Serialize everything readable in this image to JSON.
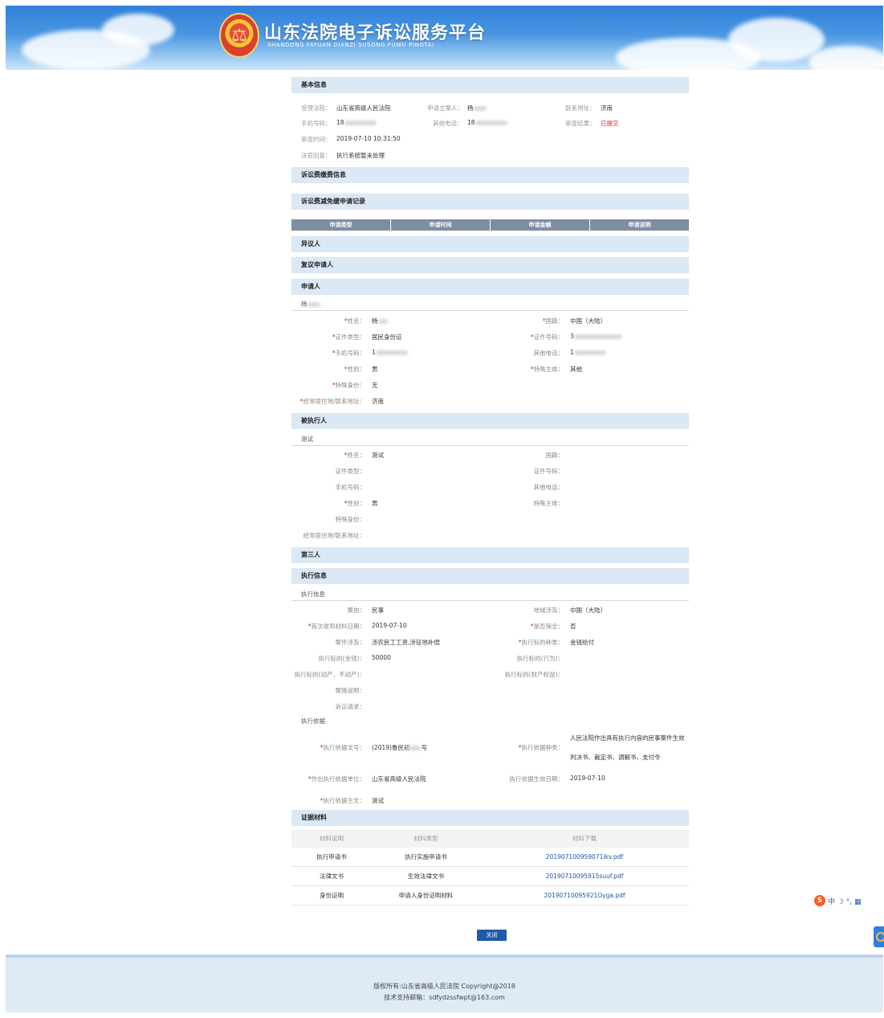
{
  "header": {
    "title": "山东法院电子诉讼服务平台",
    "subtitle": "SHANDONG FAYUAN DIANZI SUSONG FUWU PINGTAI"
  },
  "basic": {
    "title": "基本信息",
    "court_label": "受理法院：",
    "court_value": "山东省高级人民法院",
    "applicant_label": "申请立案人：",
    "applicant_value": "杨",
    "address_label": "联系地址：",
    "address_value": "济南",
    "phone_label": "手机号码：",
    "phone_value": "18",
    "other_phone_label": "其他电话：",
    "other_phone_value": "18",
    "result_label": "审查结果：",
    "result_value": "已提交",
    "review_time_label": "审查时间：",
    "review_time_value": "2019-07-10 10:31:50",
    "reply_label": "法官回复：",
    "reply_value": "执行系统暂未处理"
  },
  "fee_title": "诉讼费缴费信息",
  "reduce": {
    "title": "诉讼费减免缓申请记录",
    "columns": [
      "申请类型",
      "申请时间",
      "申请金额",
      "申请说明"
    ]
  },
  "objector_title": "异议人",
  "review_applicant_title": "复议申请人",
  "applicant": {
    "title": "申请人",
    "sub": "杨",
    "name_label": "姓名：",
    "name_value": "杨",
    "nation_label": "国籍：",
    "nation_value": "中国（大陆）",
    "idtype_label": "证件类型：",
    "idtype_value": "居民身份证",
    "idno_label": "证件号码：",
    "idno_value": "3",
    "phone_label": "手机号码：",
    "phone_value": "1",
    "other_label": "其他电话：",
    "other_value": "1",
    "gender_label": "性别：",
    "gender_value": "男",
    "special_subject_label": "特殊主体：",
    "special_subject_value": "其他",
    "special_identity_label": "特殊身份：",
    "special_identity_value": "无",
    "address_label": "经常居住地/联系地址：",
    "address_value": "济南"
  },
  "respondent": {
    "title": "被执行人",
    "sub": "测试",
    "name_label": "姓名：",
    "name_value": "测试",
    "nation_label": "国籍：",
    "idtype_label": "证件类型：",
    "idno_label": "证件号码：",
    "phone_label": "手机号码：",
    "other_label": "其他电话：",
    "gender_label": "性别：",
    "gender_value": "男",
    "special_subject_label": "特殊主体：",
    "special_identity_label": "特殊身份：",
    "address_label": "经常居住地/联系地址："
  },
  "third_title": "第三人",
  "exec": {
    "title": "执行信息",
    "sub": "执行信息",
    "cause_label": "案由：",
    "cause_value": "民事",
    "region_label": "地域涉及：",
    "region_value": "中国（大陆）",
    "first_date_label": "首次收到材料日期：",
    "first_date_value": "2019-07-10",
    "preserve_label": "是否保全：",
    "preserve_value": "否",
    "involve_label": "案件涉及：",
    "involve_value": "涉农民工工资,涉征地补偿",
    "kind_label": "执行标的种类：",
    "kind_value": "金钱给付",
    "money_label": "执行标的(金钱)：",
    "money_value": "50000",
    "action_label": "执行标的(行为)：",
    "estate_label": "执行标的(动产、不动产)：",
    "property_label": "执行标的(财产权益)：",
    "desc_label": "案情说明：",
    "claim_label": "诉讼请求：",
    "basis_sub": "执行依据",
    "basis_no_label": "执行依据文号：",
    "basis_no_value": "(2019)鲁民初",
    "basis_no_suffix": "号",
    "basis_kind_label": "执行依据种类：",
    "basis_kind_value1": "人民法院作出具有执行内容的民事案件生效",
    "basis_kind_value2": "判决书、裁定书、调解书、支付令",
    "basis_unit_label": "作出执行依据单位：",
    "basis_unit_value": "山东省高级人民法院",
    "basis_date_label": "执行依据生效日期：",
    "basis_date_value": "2019-07-10",
    "basis_text_label": "执行依据主文：",
    "basis_text_value": "测试"
  },
  "evidence": {
    "title": "证据材料",
    "columns": [
      "材料说明",
      "材料类型",
      "材料下载"
    ],
    "rows": [
      {
        "desc": "执行申请书",
        "type": "执行实施申请书",
        "file": "201907100959071ikv.pdf"
      },
      {
        "desc": "法律文书",
        "type": "生效法律文书",
        "file": "20190710095915suuf.pdf"
      },
      {
        "desc": "身份证明",
        "type": "申请人身份证明材料",
        "file": "20190710095921Oyga.pdf"
      }
    ]
  },
  "close_button": "关闭",
  "footer": {
    "copyright": "版权所有:山东省高级人民法院 Copyright@2018",
    "support": "技术支持邮箱：sdfydzssfwpt@163.com"
  },
  "required_mark": "*",
  "ime": {
    "logo": "S",
    "text": "中 ☽ °, ▦"
  }
}
